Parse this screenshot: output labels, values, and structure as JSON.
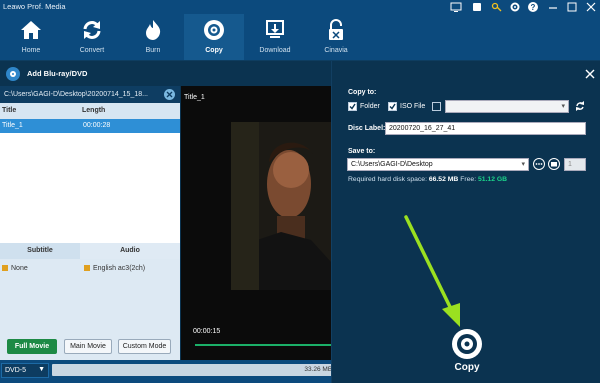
{
  "app": {
    "title": "Leawo Prof. Media"
  },
  "toolbar": {
    "items": [
      {
        "label": "Home",
        "icon": "home-icon"
      },
      {
        "label": "Convert",
        "icon": "convert-icon"
      },
      {
        "label": "Burn",
        "icon": "burn-icon"
      },
      {
        "label": "Copy",
        "icon": "copy-icon",
        "active": true
      },
      {
        "label": "Download",
        "icon": "download-icon"
      },
      {
        "label": "Cinavia",
        "icon": "cinavia-icon"
      }
    ]
  },
  "add_bar": {
    "label": "Add Blu-ray/DVD"
  },
  "left_panel": {
    "path": "C:\\Users\\GAGI-D\\Desktop\\20200714_15_18...",
    "columns": [
      "Title",
      "Length"
    ],
    "rows": [
      {
        "title": "Title_1",
        "length": "00:00:28"
      }
    ],
    "sub_headers": [
      "Subtitle",
      "Audio"
    ],
    "subtitle_value": "None",
    "audio_value": "English ac3(2ch)",
    "mode_buttons": [
      "Full Movie",
      "Main Movie",
      "Custom Mode"
    ]
  },
  "player": {
    "title": "Title_1",
    "time": "00:00:15",
    "progress_fraction": 1.0
  },
  "status": {
    "disc_type": "DVD-5",
    "capacity_text": "33.26 MB/"
  },
  "dialog": {
    "copy_to_label": "Copy to:",
    "folder_label": "Folder",
    "iso_label": "ISO File",
    "disc_label_label": "Disc Label:",
    "disc_label_value": "20200720_16_27_41",
    "save_to_label": "Save to:",
    "save_path": "C:\\Users\\GAGI-D\\Desktop",
    "count_value": "1",
    "hdd_prefix": "Required hard disk space: ",
    "hdd_required": "66.52 MB",
    "hdd_free_label": " Free: ",
    "hdd_free": "51.12 GB",
    "copy_button": "Copy",
    "accent_color": "#9be020"
  },
  "colors": {
    "toolbar": "#0c4a7d",
    "selection": "#2e8fd6",
    "free_space": "#1bd38a",
    "full_movie": "#1d8a45"
  }
}
